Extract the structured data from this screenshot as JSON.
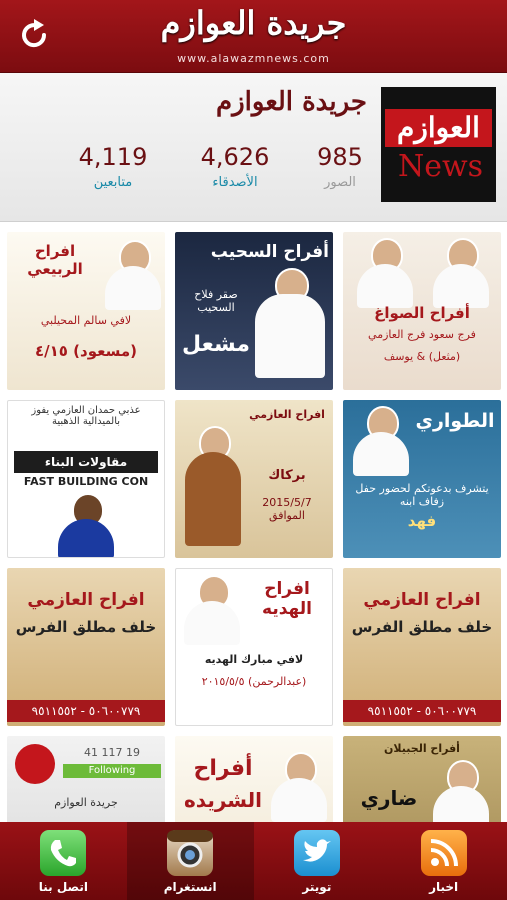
{
  "header": {
    "title": "جريدة العوازم",
    "url": "www.alawazmnews.com"
  },
  "profile": {
    "logo_ar": "العوازم",
    "logo_en": "News",
    "name": "جريدة العوازم",
    "stats": [
      {
        "value": "985",
        "label": "الصور"
      },
      {
        "value": "4,626",
        "label": "الأصدقاء"
      },
      {
        "value": "4,119",
        "label": "متابعين"
      }
    ]
  },
  "tiles": [
    {
      "l1": "أفراح الصواغ",
      "l2": "فرج سعود فرج العازمي",
      "l3": "(مثعل) & يوسف"
    },
    {
      "l1": "أفراح السحيب",
      "l2": "صقر فلاح السحيب",
      "l3": "مشعل"
    },
    {
      "l1": "افراح الربيعي",
      "l2": "لافي سالم المحيلبي",
      "l3": "(مسعود) ٤/١٥"
    },
    {
      "l1": "الطواري",
      "l2": "يتشرف بدعوتكم لحضور حفل زفاف ابنه",
      "l3": "فهد"
    },
    {
      "l1": "افراح العازمي",
      "l2": "بركاك",
      "l3": "2015/5/7 الموافق"
    },
    {
      "l1": "عذبي حمدان العازمي يفوز بالميدالية الذهبية",
      "l2": "مقاولات البناء",
      "l3": "FAST BUILDING CON"
    },
    {
      "l1": "افراح العازمي",
      "l2": "خلف مطلق الفرس",
      "l3": "٥٠٦٠٠٧٧٩ - ٩٥١١٥٥٢"
    },
    {
      "l1": "افراح الهديه",
      "l2": "لافي مبارك الهديه",
      "l3": "(عبدالرحمن) ٢٠١٥/٥/٥"
    },
    {
      "l1": "افراح العازمي",
      "l2": "خلف مطلق الفرس",
      "l3": "٥٠٦٠٠٧٧٩ - ٩٥١١٥٥٢"
    },
    {
      "l1": "أفراح الجبيلان",
      "l2": "ضاري",
      "l3": ""
    },
    {
      "l1": "أفراح",
      "l2": "الشريده",
      "l3": ""
    },
    {
      "l1": "Following",
      "l2": "جريدة العوازم",
      "l3": "41   117   19"
    }
  ],
  "nav": [
    {
      "label": "اتصل بنا",
      "icon": "phone-icon"
    },
    {
      "label": "انستغرام",
      "icon": "instagram-icon"
    },
    {
      "label": "تويتر",
      "icon": "twitter-icon"
    },
    {
      "label": "اخبار",
      "icon": "rss-icon"
    }
  ]
}
